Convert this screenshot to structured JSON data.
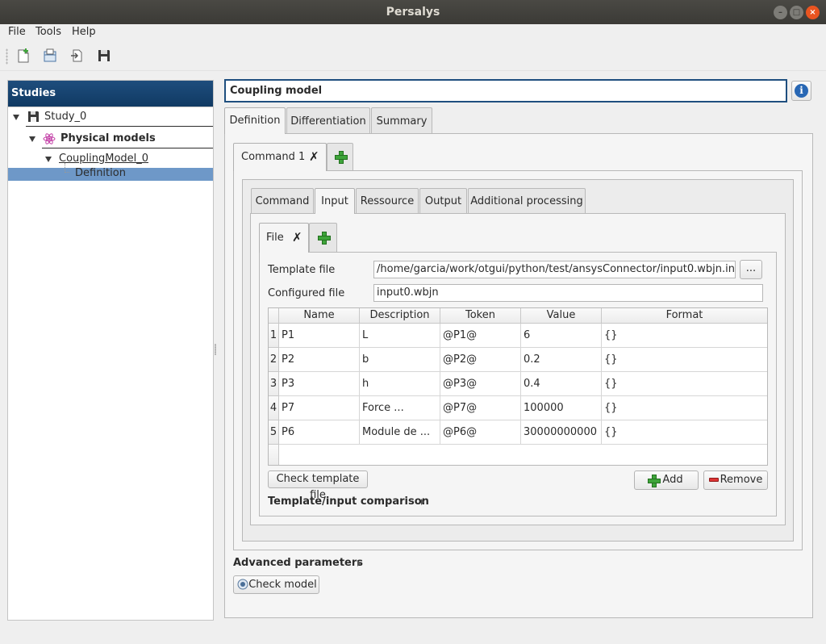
{
  "window": {
    "title": "Persalys"
  },
  "menu": {
    "file": "File",
    "tools": "Tools",
    "help": "Help"
  },
  "sidebar": {
    "header": "Studies",
    "study": "Study_0",
    "physical_models": "Physical models",
    "model": "CouplingModel_0",
    "definition": "Definition"
  },
  "main": {
    "title": "Coupling model",
    "tabs": [
      "Definition",
      "Differentiation",
      "Summary"
    ],
    "command_tab": "Command 1",
    "inner_tabs": [
      "Command",
      "Input",
      "Ressource",
      "Output",
      "Additional processing"
    ],
    "file_tab": "File",
    "template_label": "Template file",
    "template_value": "/home/garcia/work/otgui/python/test/ansysConnector/input0.wbjn.in",
    "browse_label": "...",
    "configured_label": "Configured file",
    "configured_value": "input0.wbjn",
    "table": {
      "headers": [
        "Name",
        "Description",
        "Token",
        "Value",
        "Format"
      ],
      "rows": [
        {
          "index": "1",
          "name": "P1",
          "description": "L",
          "token": "@P1@",
          "value": "6",
          "format": "{}"
        },
        {
          "index": "2",
          "name": "P2",
          "description": "b",
          "token": "@P2@",
          "value": "0.2",
          "format": "{}"
        },
        {
          "index": "3",
          "name": "P3",
          "description": "h",
          "token": "@P3@",
          "value": "0.4",
          "format": "{}"
        },
        {
          "index": "4",
          "name": "P7",
          "description": "Force ...",
          "token": "@P7@",
          "value": "100000",
          "format": "{}"
        },
        {
          "index": "5",
          "name": "P6",
          "description": "Module de ...",
          "token": "@P6@",
          "value": "30000000000",
          "format": "{}"
        }
      ]
    },
    "check_template": "Check template file",
    "add": "Add",
    "remove": "Remove",
    "comparison": "Template/input comparison",
    "advanced": "Advanced parameters",
    "check_model": "Check model"
  }
}
